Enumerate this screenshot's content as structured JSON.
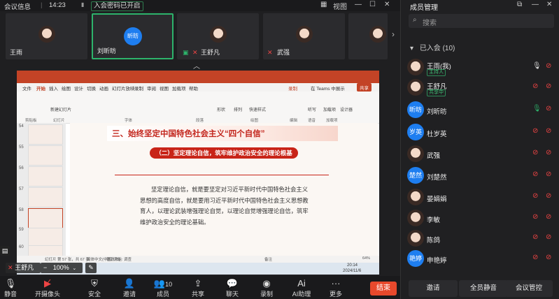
{
  "topbar": {
    "title": "会议信息",
    "time": "14:23",
    "encryption": "入会密码已开启",
    "view_label": "视图"
  },
  "video_tiles": [
    {
      "name": "王雨",
      "type": "photo"
    },
    {
      "name": "刘昕昉",
      "type": "avatar",
      "avatar_text": "昕昉"
    },
    {
      "name": "王舒凡",
      "type": "photo"
    },
    {
      "name": "武强",
      "type": "photo"
    }
  ],
  "shared_screen": {
    "ppt_tabs": [
      "文件",
      "开始",
      "插入",
      "绘图",
      "设计",
      "切换",
      "动画",
      "幻灯片放映",
      "录制",
      "审阅",
      "视图",
      "加载项",
      "帮助"
    ],
    "ppt_right": [
      "录制",
      "在 Teams 中展示",
      "共享"
    ],
    "ribbon_labels": [
      "剪贴板",
      "幻灯片",
      "字体",
      "段落",
      "绘图",
      "编辑",
      "语音",
      "加载项",
      "设计器",
      "新建幻灯片",
      "形状",
      "排列",
      "快速样式",
      "听写",
      "加载项",
      "设计器"
    ],
    "thumb_numbers": [
      "54",
      "55",
      "56",
      "57",
      "58",
      "59",
      "60",
      "61"
    ],
    "slide_title": "三、始终坚定中国特色社会主义“四个自信”",
    "slide_subtitle": "（二）坚定理论自信，筑牢维护政治安全的理论根基",
    "slide_paragraph": "坚定理论自信，就是要坚定对习近平新时代中国特色社会主义思想的高度自信，就是要用习近平新时代中国特色社会主义思想教育人，以理论武装增强理论自觉，以理论自觉增强理论自信，筑牢维护政治安全的理论基础。",
    "status_left": "幻灯片 第 57 张，共 67 张",
    "status_lang": "简体中文(中国大陆)",
    "status_access": "辅助功能: 调查",
    "status_notes": "备注",
    "status_zoom": "64%",
    "clock_time": "20:14",
    "clock_date": "2024/11/6"
  },
  "zoom_control": {
    "presenter": "王舒凡",
    "zoom_level": "100%",
    "minus": "−",
    "plus": "+"
  },
  "toolbar": [
    {
      "label": "静音",
      "icon": "mic-icon"
    },
    {
      "label": "开摄像头",
      "icon": "camera-off-icon"
    },
    {
      "label": "安全",
      "icon": "shield-icon"
    },
    {
      "label": "邀请",
      "icon": "add-user-icon"
    },
    {
      "label": "成员",
      "icon": "members-icon",
      "badge": "10"
    },
    {
      "label": "共享",
      "icon": "share-icon"
    },
    {
      "label": "聊天",
      "icon": "chat-icon"
    },
    {
      "label": "录制",
      "icon": "record-icon"
    },
    {
      "label": "AI助理",
      "icon": "ai-icon"
    },
    {
      "label": "更多",
      "icon": "more-icon"
    }
  ],
  "end_label": "结束",
  "panel": {
    "title": "成员管理",
    "search_placeholder": "搜索",
    "group_label": "已入会 (10)",
    "members": [
      {
        "name": "王雨(我)",
        "tag": "主持人",
        "avatar": "photo",
        "mic": "on"
      },
      {
        "name": "王舒凡",
        "tag": "共享中",
        "avatar": "photo",
        "mic": "off"
      },
      {
        "name": "刘昕昉",
        "tag": "",
        "avatar": "text",
        "avatar_text": "昕昉",
        "mic": "active"
      },
      {
        "name": "杜岁英",
        "tag": "",
        "avatar": "text",
        "avatar_text": "岁英",
        "mic": "off"
      },
      {
        "name": "武强",
        "tag": "",
        "avatar": "photo",
        "mic": "off"
      },
      {
        "name": "刘楚然",
        "tag": "",
        "avatar": "text",
        "avatar_text": "楚然",
        "mic": "off"
      },
      {
        "name": "晏娟娟",
        "tag": "",
        "avatar": "photo",
        "mic": "off"
      },
      {
        "name": "李敏",
        "tag": "",
        "avatar": "photo",
        "mic": "off"
      },
      {
        "name": "陈鸽",
        "tag": "",
        "avatar": "photo",
        "mic": "off"
      },
      {
        "name": "申艳婷",
        "tag": "",
        "avatar": "text",
        "avatar_text": "艳婷",
        "mic": "off"
      }
    ],
    "buttons": [
      "邀请",
      "全员静音",
      "会议管控"
    ]
  },
  "colors": {
    "accent_green": "#2db36b",
    "ppt_red": "#c34326",
    "end_red": "#e8492c",
    "avatar_blue": "#1e7ef0"
  }
}
